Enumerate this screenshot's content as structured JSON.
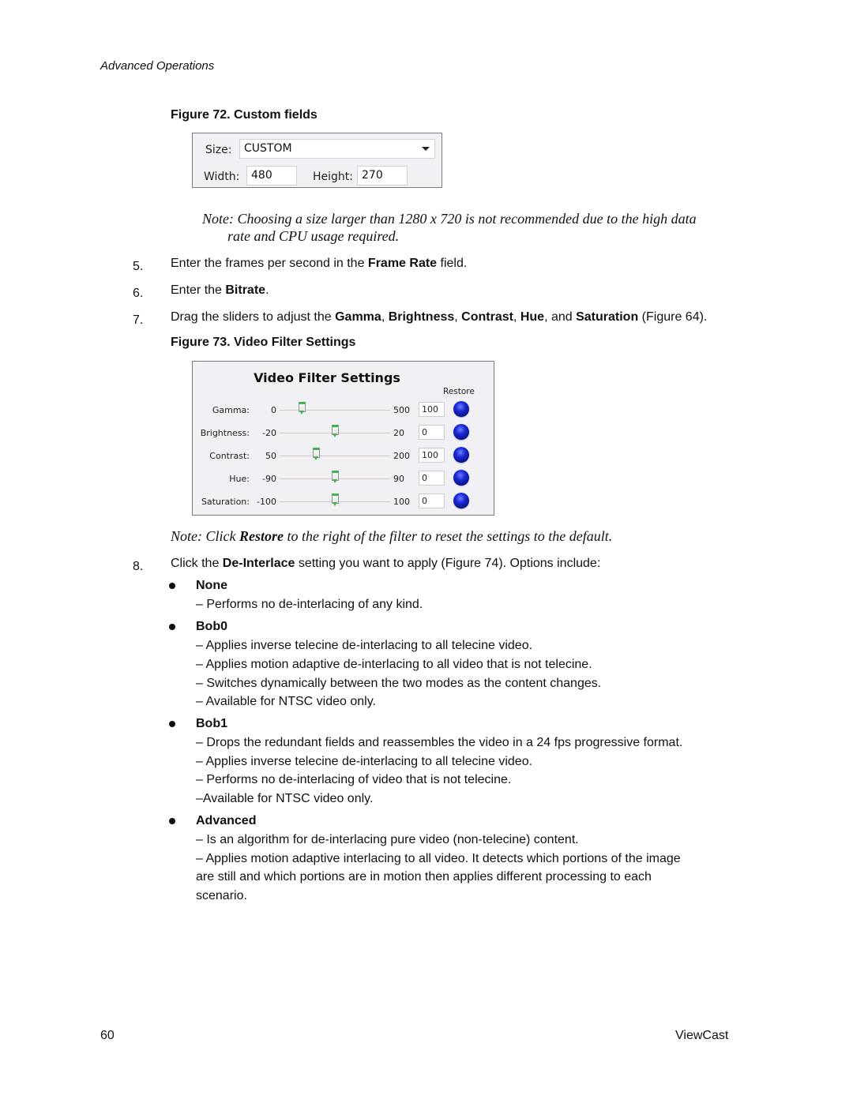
{
  "header": {
    "section": "Advanced Operations"
  },
  "figure72": {
    "caption": "Figure 72. Custom fields",
    "size_label": "Size:",
    "size_value": "CUSTOM",
    "width_label": "Width:",
    "width_value": "480",
    "height_label": "Height:",
    "height_value": "270"
  },
  "note1": {
    "line1": "Note: Choosing a size larger than 1280 x 720 is not recommended due to the high data",
    "line2": "rate and CPU usage required."
  },
  "steps": [
    {
      "num": "5.",
      "pre": "Enter the frames per second in the ",
      "bold": "Frame Rate",
      "post": " field."
    },
    {
      "num": "6.",
      "pre": "Enter the ",
      "bold": "Bitrate",
      "post": "."
    },
    {
      "num": "7.",
      "pre": "Drag the sliders to adjust the ",
      "b1": "Gamma",
      "s1": ", ",
      "b2": "Brightness",
      "s2": ", ",
      "b3": "Contrast",
      "s3": ", ",
      "b4": "Hue",
      "s4": ", and ",
      "b5": "Saturation",
      "post": " (Figure 64)."
    }
  ],
  "figure73": {
    "caption": "Figure 73. Video Filter Settings",
    "title": "Video Filter Settings",
    "restore_header": "Restore",
    "filters": [
      {
        "name": "Gamma:",
        "min": "0",
        "max": "500",
        "value": "100",
        "position": 0.2
      },
      {
        "name": "Brightness:",
        "min": "-20",
        "max": "20",
        "value": "0",
        "position": 0.5
      },
      {
        "name": "Contrast:",
        "min": "50",
        "max": "200",
        "value": "100",
        "position": 0.33
      },
      {
        "name": "Hue:",
        "min": "-90",
        "max": "90",
        "value": "0",
        "position": 0.5
      },
      {
        "name": "Saturation:",
        "min": "-100",
        "max": "100",
        "value": "0",
        "position": 0.5
      }
    ]
  },
  "note2": {
    "pre": "Note: Click ",
    "bold": "Restore",
    "post": " to the right of the filter to reset the settings to the default."
  },
  "step8": {
    "num": "8.",
    "pre": "Click the ",
    "bold": "De-Interlace",
    "post": " setting you want to apply (Figure 74). Options include:"
  },
  "options": [
    {
      "name": "None",
      "lines": [
        "– Performs no de-interlacing of any kind."
      ]
    },
    {
      "name": "Bob0",
      "lines": [
        "– Applies inverse telecine de-interlacing to all telecine video.",
        "– Applies motion adaptive de-interlacing to all video that is not telecine.",
        "– Switches dynamically between the two modes as the content changes.",
        "– Available for NTSC video only."
      ]
    },
    {
      "name": "Bob1",
      "lines": [
        "– Drops the redundant fields and reassembles the video in a 24 fps progressive format.",
        "– Applies inverse telecine de-interlacing to all telecine video.",
        "– Performs no de-interlacing of video that is not telecine.",
        "–Available for NTSC video only."
      ]
    },
    {
      "name": "Advanced",
      "lines": [
        "– Is an algorithm for de-interlacing pure video (non-telecine) content.",
        "– Applies motion adaptive interlacing to all video. It detects which portions of the image",
        "are still and which portions are in motion then applies different processing to each",
        "scenario."
      ]
    }
  ],
  "footer": {
    "page_number": "60",
    "brand": "ViewCast"
  }
}
